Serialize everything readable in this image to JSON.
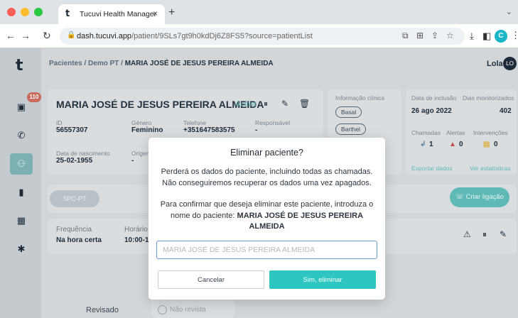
{
  "browser": {
    "tab_title": "Tucuvi Health Manager",
    "tab_logo": "t",
    "tab_close": "×",
    "new_tab": "+",
    "url_host": "dash.tucuvi.app",
    "url_path": "/patient/9SLs7gt9h0kdDj6Z8FS5?source=patientList",
    "profile_initial": "C",
    "colors": {
      "close": "#fe5f57",
      "minimize": "#febc2e",
      "maximize": "#28c840",
      "profile": "#18b6c6"
    }
  },
  "app": {
    "logo": "t",
    "breadcrumb": {
      "root": "Pacientes / Demo PT / ",
      "current": "MARIA JOSÉ DE JESUS PEREIRA ALMEIDA"
    },
    "user": {
      "name": "Lola",
      "initials": "LO"
    },
    "sidebar": {
      "badge": "110",
      "items": [
        "dashboard-icon",
        "phone-icon",
        "patients-icon",
        "chart-icon",
        "calendar-icon",
        "settings-icon"
      ],
      "active_index": 2
    },
    "patient": {
      "name": "MARIA JOSÉ DE JESUS PEREIRA ALMEIDA",
      "status": "Activo",
      "id_label": "ID",
      "id_value": "56557307",
      "gender_label": "Género",
      "gender_value": "Feminino",
      "phone_label": "Telefone",
      "phone_value": "+351647583575",
      "responsible_label": "Responsável",
      "responsible_value": "-",
      "birth_label": "Data de nascimento",
      "birth_value": "25-02-1955",
      "origin_label": "Origem",
      "origin_value": "-"
    },
    "clinical": {
      "title": "Informação clínica",
      "pills": [
        "Basal",
        "Barthel"
      ]
    },
    "stats": {
      "inclusion_label": "Data de inclusão",
      "inclusion_value": "26 ago 2022",
      "days_label": "Dias monitorizados",
      "days_value": "402",
      "calls_label": "Chamadas",
      "calls_value": "1",
      "alerts_label": "Alertas",
      "alerts_value": "0",
      "interventions_label": "Intervenções",
      "interventions_value": "0",
      "export_label": "Exportar dados",
      "view_stats_label": "Ver estatísticas"
    },
    "program": {
      "label": "SPC-PT",
      "create_call_label": "Criar ligação"
    },
    "schedule": {
      "frequency_label": "Frequência",
      "frequency_value": "Na hora certa",
      "time_label": "Horário",
      "time_value": "10:00-1"
    },
    "review": {
      "label": "Revisado",
      "option": "Não revista"
    }
  },
  "modal": {
    "title": "Eliminar paciente?",
    "body_1": "Perderá os dados do paciente, incluindo todas as chamadas. Não conseguiremos recuperar os dados uma vez apagados.",
    "body_2_prefix": "Para confirmar que deseja eliminar este paciente, introduza o nome do paciente: ",
    "body_2_name": "MARIA JOSÉ DE JESUS PEREIRA ALMEIDA",
    "input_placeholder": "MARIA JOSÉ DE JESUS PEREIRA ALMEIDA",
    "input_value": "",
    "cancel_label": "Cancelar",
    "confirm_label": "Sim, eliminar"
  }
}
